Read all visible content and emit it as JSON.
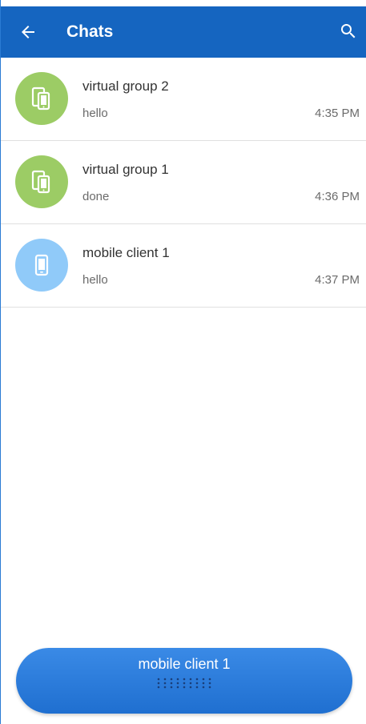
{
  "appbar": {
    "title": "Chats",
    "back_icon": "arrow-left-icon",
    "search_icon": "search-icon",
    "color": "#1565c0"
  },
  "chats": [
    {
      "name": "virtual group 2",
      "preview": "hello",
      "time": "4:35 PM",
      "avatar_icon": "devices-icon",
      "avatar_color": "#9ccc65"
    },
    {
      "name": "virtual group 1",
      "preview": "done",
      "time": "4:36 PM",
      "avatar_icon": "devices-icon",
      "avatar_color": "#9ccc65"
    },
    {
      "name": "mobile client 1",
      "preview": "hello",
      "time": "4:37 PM",
      "avatar_icon": "smartphone-icon",
      "avatar_color": "#90caf9"
    }
  ],
  "bottom_bar": {
    "label": "mobile client 1",
    "handle_icon": "drag-handle-icon"
  }
}
